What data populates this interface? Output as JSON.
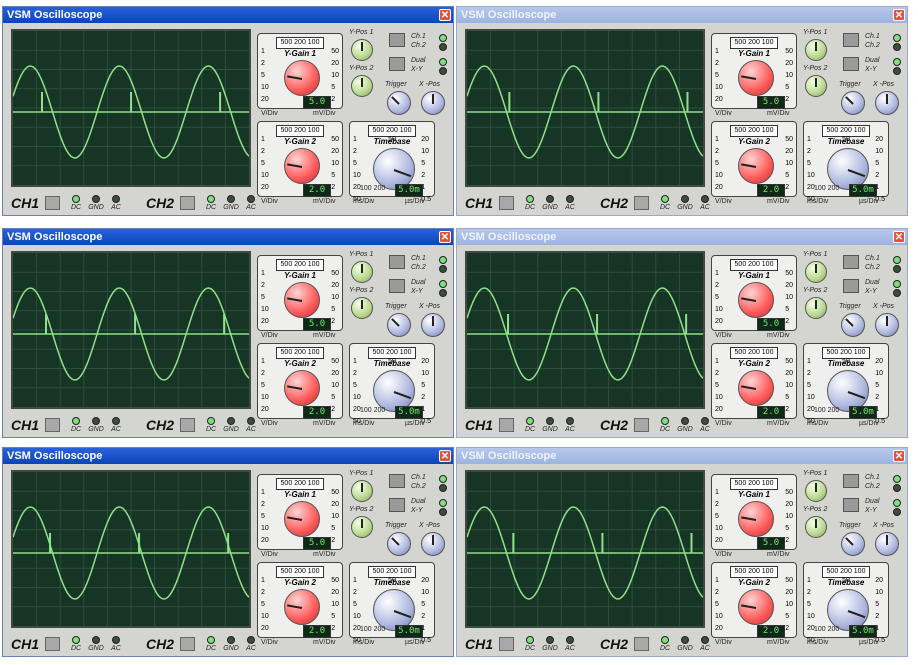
{
  "window_title": "VSM Oscilloscope",
  "close_glyph": "✕",
  "channels": [
    "CH1",
    "CH2"
  ],
  "coupling": [
    "DC",
    "GND",
    "AC"
  ],
  "ygain1": {
    "name": "Y-Gain 1",
    "top_scale": "500 200 100",
    "left_scale": [
      "1",
      "2",
      "5",
      "10",
      "20"
    ],
    "right_scale": [
      "50",
      "20",
      "10",
      "5",
      "2"
    ],
    "readout": "5.0",
    "unit_left": "V/Div",
    "unit_right": "mV/Div"
  },
  "ygain2": {
    "name": "Y-Gain 2",
    "top_scale": "500 200 100",
    "left_scale": [
      "1",
      "2",
      "5",
      "10",
      "20"
    ],
    "right_scale": [
      "50",
      "20",
      "10",
      "5",
      "2"
    ],
    "readout": "2.0",
    "unit_left": "V/Div",
    "unit_right": "mV/Div"
  },
  "timebase": {
    "name": "Timebase",
    "top_scale": "500 200 100 50",
    "left_scale": [
      "1",
      "2",
      "5",
      "10",
      "20",
      "50"
    ],
    "right_scale": [
      "20",
      "10",
      "5",
      "2",
      "1",
      "0.5"
    ],
    "bottom_left": "100 200",
    "readout": "5.0m",
    "unit_left": "ms/Div",
    "unit_right": "µs/Div"
  },
  "labels": {
    "ypos1": "Y-Pos 1",
    "ypos2": "Y-Pos 2",
    "trigger": "Trigger",
    "xpos": "X -Pos",
    "ch1": "Ch.1",
    "ch2": "Ch.2",
    "dual": "Dual",
    "xy": "X-Y"
  },
  "colors": {
    "trace": "#8fe08b",
    "screen": "#173524",
    "grid": "#2f4d3b",
    "title_active": "#0b44b8",
    "title_inactive": "#9db3e0"
  },
  "scopes": [
    {
      "active": true,
      "spike_phase": 0.0
    },
    {
      "active": false,
      "spike_phase": 0.5
    },
    {
      "active": true,
      "spike_phase": 0.15
    },
    {
      "active": false,
      "spike_phase": 0.45
    },
    {
      "active": true,
      "spike_phase": 0.3
    },
    {
      "active": false,
      "spike_phase": 0.65
    }
  ]
}
